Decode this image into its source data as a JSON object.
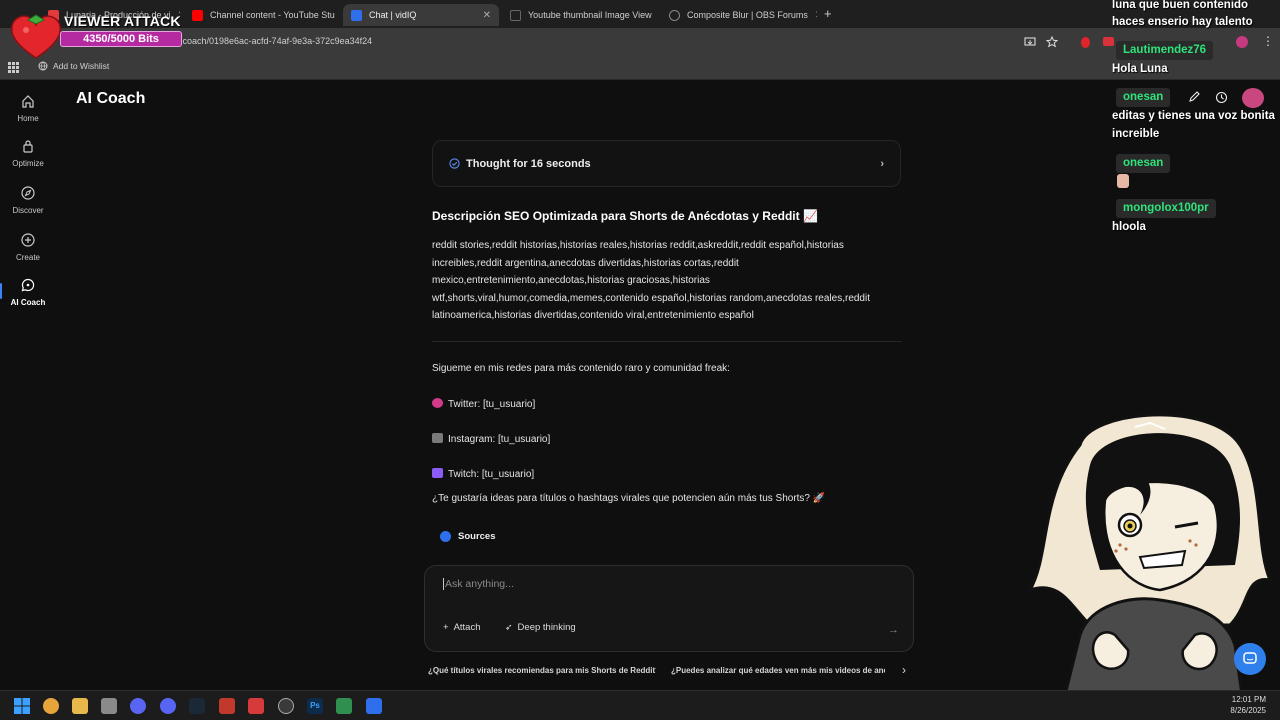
{
  "browser": {
    "tabs": [
      {
        "label": "Lunaria - Producción de vi",
        "active": false,
        "favicon_color": "#e23b3b"
      },
      {
        "label": "Channel content - YouTube Stu",
        "active": false,
        "favicon_color": "#ff0000"
      },
      {
        "label": "Chat | vidIQ",
        "active": true,
        "favicon_color": "#2f6fed"
      },
      {
        "label": "Youtube thumbnail Image View",
        "active": false,
        "favicon_color": "#555555"
      },
      {
        "label": "Composite Blur | OBS Forums",
        "active": false,
        "favicon_color": "#777777"
      }
    ],
    "url": "/ai-coach/0198e6ac-acfd-74af-9e3a-372c9ea34f24",
    "bookmark": "Add to Wishlist"
  },
  "overlay": {
    "title": "VIEWER ATTACK",
    "bits": "4350/5000 Bits",
    "bits_progress": 0.87
  },
  "sidebar": {
    "items": [
      {
        "label": "Home",
        "icon": "home-icon"
      },
      {
        "label": "Optimize",
        "icon": "lock-icon"
      },
      {
        "label": "Discover",
        "icon": "compass-icon"
      },
      {
        "label": "Create",
        "icon": "plus-circle-icon"
      },
      {
        "label": "AI Coach",
        "icon": "chat-bubble-icon",
        "active": true
      }
    ]
  },
  "page": {
    "title": "AI Coach"
  },
  "chat": {
    "thought": "Thought for 16 seconds",
    "heading": "Descripción SEO Optimizada para Shorts de Anécdotas y Reddit 📈",
    "tags": "reddit stories,reddit historias,historias reales,historias reddit,askreddit,reddit español,historias increibles,reddit argentina,anecdotas divertidas,historias cortas,reddit mexico,entretenimiento,anecdotas,historias graciosas,historias wtf,shorts,viral,humor,comedia,memes,contenido español,historias random,anecdotas reales,reddit latinoamerica,historias divertidas,contenido viral,entretenimiento español",
    "follow": "Sigueme en mis redes para más contenido raro y comunidad freak:",
    "twitter": "Twitter: [tu_usuario]",
    "instagram": "Instagram: [tu_usuario]",
    "twitch": "Twitch: [tu_usuario]",
    "question": "¿Te gustaría ideas para títulos o hashtags virales que potencien aún más tus Shorts? 🚀",
    "sources": "Sources"
  },
  "composer": {
    "placeholder": "Ask anything...",
    "attach": "Attach",
    "deep": "Deep thinking"
  },
  "suggestions": [
    "¿Qué títulos virales recomiendas para mis Shorts de Reddit?",
    "¿Puedes analizar qué edades ven más mis videos de anécdotas"
  ],
  "twitch_chat": {
    "top_line1": "luna que buen contenido",
    "top_line2": "haces enserio hay talento",
    "messages": [
      {
        "user": "Lautimendez76",
        "text": "Hola Luna"
      },
      {
        "user": "onesan",
        "text": "editas y tienes una voz bonita increible"
      },
      {
        "user": "onesan",
        "text": ""
      },
      {
        "user": "mongolox100pr",
        "text": "hloola"
      }
    ]
  },
  "taskbar": {
    "time": "12:01 PM",
    "date": "8/26/2025"
  },
  "colors": {
    "accent": "#3b82f6",
    "chat_name": "#2ee37a",
    "bits_bar": "#b52aa0"
  }
}
